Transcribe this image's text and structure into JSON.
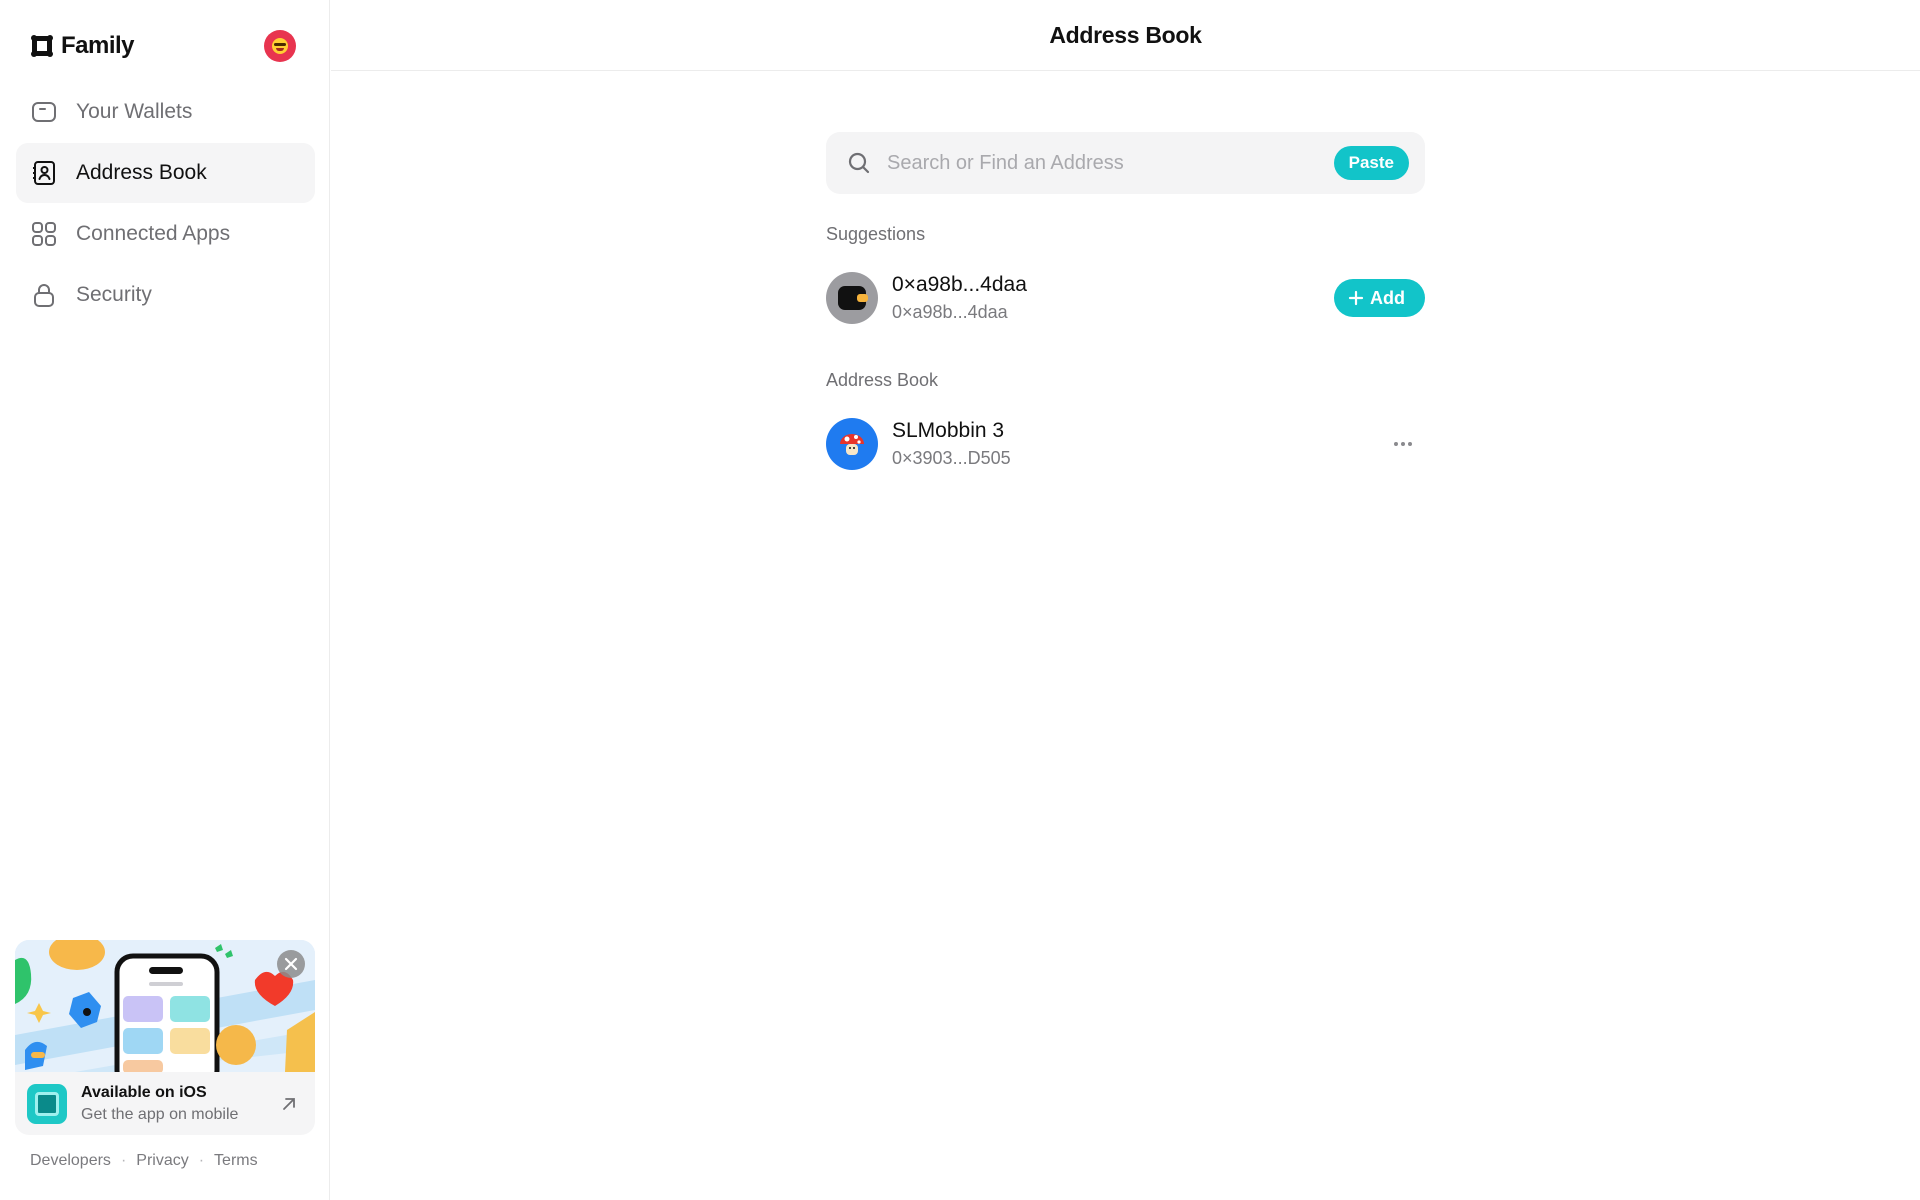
{
  "app": {
    "name": "Family"
  },
  "sidebar": {
    "items": [
      {
        "label": "Your Wallets",
        "icon": "wallet-icon",
        "active": false
      },
      {
        "label": "Address Book",
        "icon": "contact-book-icon",
        "active": true
      },
      {
        "label": "Connected Apps",
        "icon": "grid-apps-icon",
        "active": false
      },
      {
        "label": "Security",
        "icon": "lock-icon",
        "active": false
      }
    ],
    "promo": {
      "title": "Available on iOS",
      "subtitle": "Get the app on mobile"
    },
    "footer": {
      "developers": "Developers",
      "privacy": "Privacy",
      "terms": "Terms",
      "separator": "·"
    }
  },
  "header": {
    "title": "Address Book"
  },
  "search": {
    "placeholder": "Search or Find an Address",
    "value": "",
    "paste_label": "Paste"
  },
  "suggestions": {
    "label": "Suggestions",
    "items": [
      {
        "name": "0×a98b...4daa",
        "address": "0×a98b...4daa",
        "action_label": "Add"
      }
    ]
  },
  "address_book": {
    "label": "Address Book",
    "items": [
      {
        "name": "SLMobbin 3",
        "address": "0×3903...D505"
      }
    ]
  },
  "colors": {
    "accent": "#12c4c9",
    "profile_avatar": "#e8344f",
    "contact_avatar": "#1f7bf0",
    "suggestion_avatar": "#9c9ca0"
  }
}
